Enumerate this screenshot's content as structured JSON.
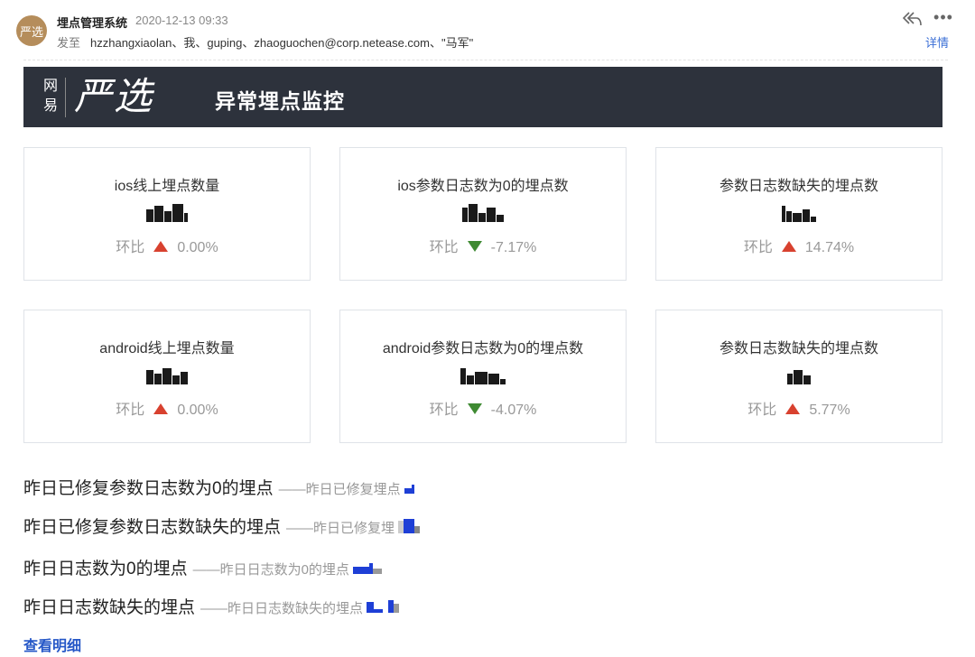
{
  "email": {
    "avatar_text": "严选",
    "sender": "埋点管理系统",
    "time": "2020-12-13 09:33",
    "to_label": "发至",
    "recipients": "hzzhangxiaolan、我、guping、zhaoguochen@corp.netease.com、\"马军\"",
    "details_link": "详情",
    "icons": [
      "reply-all-icon",
      "more-icon"
    ]
  },
  "banner": {
    "brand_small": "网易",
    "brand_big": "严选",
    "title": "异常埋点监控",
    "background": "#2d323c"
  },
  "cards": [
    {
      "title": "ios线上埋点数量",
      "ratio_label": "环比",
      "trend": "up",
      "ratio": "0.00%"
    },
    {
      "title": "ios参数日志数为0的埋点数",
      "ratio_label": "环比",
      "trend": "down",
      "ratio": "-7.17%"
    },
    {
      "title": "参数日志数缺失的埋点数",
      "ratio_label": "环比",
      "trend": "up",
      "ratio": "14.74%"
    },
    {
      "title": "android线上埋点数量",
      "ratio_label": "环比",
      "trend": "up",
      "ratio": "0.00%"
    },
    {
      "title": "android参数日志数为0的埋点数",
      "ratio_label": "环比",
      "trend": "down",
      "ratio": "-4.07%"
    },
    {
      "title": "参数日志数缺失的埋点数",
      "ratio_label": "环比",
      "trend": "up",
      "ratio": "5.77%"
    }
  ],
  "colors": {
    "trend_up": "#d8412f",
    "trend_down": "#3f8a32",
    "link": "#2557c7"
  },
  "summaries": [
    {
      "main": "昨日已修复参数日志数为0的埋点",
      "sub": "——昨日已修复埋点"
    },
    {
      "main": "昨日已修复参数日志数缺失的埋点",
      "sub": "——昨日已修复埋"
    },
    {
      "main": "昨日日志数为0的埋点",
      "sub": "——昨日日志数为0的埋点"
    },
    {
      "main": "昨日日志数缺失的埋点",
      "sub": "——昨日日志数缺失的埋点"
    }
  ],
  "view_detail": "查看明细"
}
